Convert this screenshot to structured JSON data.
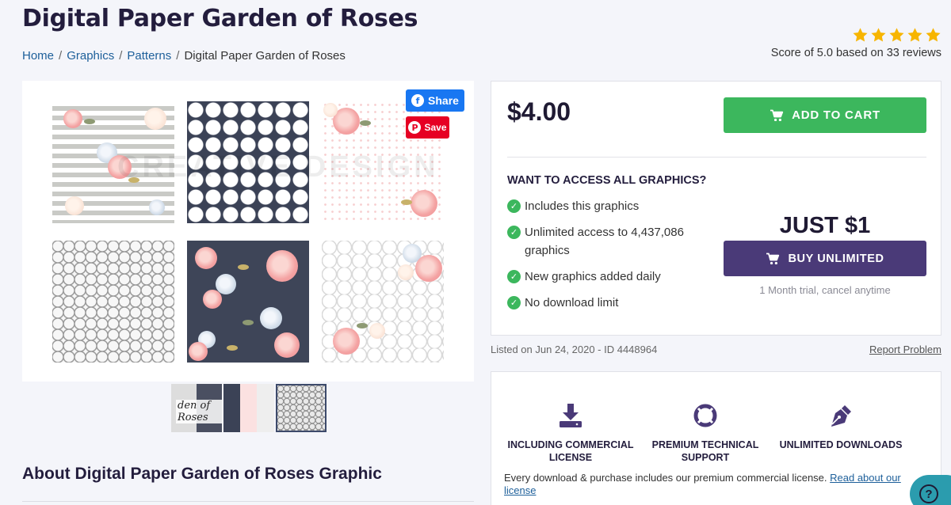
{
  "page": {
    "title": "Digital Paper Garden of Roses"
  },
  "breadcrumb": {
    "home": "Home",
    "graphics": "Graphics",
    "patterns": "Patterns",
    "current": "Digital Paper Garden of Roses",
    "separator": "/"
  },
  "rating": {
    "stars": 5,
    "max_stars": 5,
    "score_text": "Score of 5.0 based on 33 reviews",
    "star_color": "#f7b500"
  },
  "social": {
    "share_label": "Share",
    "save_label": "Save",
    "facebook_color": "#1877f2",
    "pinterest_color": "#e60023"
  },
  "preview": {
    "watermark": "CREATIVE DESIGN"
  },
  "thumbnails": {
    "first_label": "den of Roses",
    "selected_index": 2
  },
  "about": {
    "heading": "About Digital Paper Garden of Roses Graphic"
  },
  "purchase": {
    "price": "$4.00",
    "add_to_cart": "ADD TO CART",
    "access_heading": "WANT TO ACCESS ALL GRAPHICS?",
    "features": [
      "Includes this graphics",
      "Unlimited access to 4,437,086 graphics",
      "New graphics added daily",
      "No download limit"
    ],
    "just_price": "JUST $1",
    "buy_unlimited": "BUY UNLIMITED",
    "trial_note": "1 Month trial, cancel anytime",
    "cart_color": "#3cb75d",
    "unlimited_color": "#4a3a78"
  },
  "meta": {
    "listed": "Listed on Jun 24, 2020 - ID 4448964",
    "report": "Report Problem"
  },
  "benefits": {
    "items": [
      {
        "icon": "download-icon",
        "label": "INCLUDING COMMERCIAL LICENSE"
      },
      {
        "icon": "lifebuoy-icon",
        "label": "PREMIUM TECHNICAL SUPPORT"
      },
      {
        "icon": "pen-nib-icon",
        "label": "UNLIMITED DOWNLOADS"
      }
    ],
    "license_text": "Every download & purchase includes our premium commercial license.",
    "license_link": "Read about our license",
    "icon_color": "#4a3a78"
  },
  "help": {
    "label": "?"
  }
}
